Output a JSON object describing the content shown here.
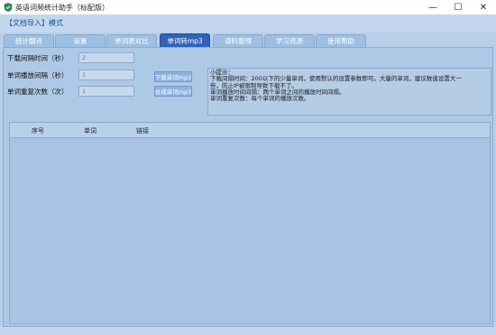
{
  "window": {
    "title": "英语词频统计助手（标配版）",
    "minimize_glyph": "—",
    "maximize_glyph": "☐",
    "close_glyph": "✕"
  },
  "mode_link": "【文档导入】模式",
  "tabs": [
    {
      "label": "统计翻译"
    },
    {
      "label": "设置"
    },
    {
      "label": "单词表对比"
    },
    {
      "label": "单词转mp3",
      "active": true
    },
    {
      "label": "语料整理"
    },
    {
      "label": "学习资源"
    },
    {
      "label": "使用帮助"
    }
  ],
  "form": {
    "download_timeout": {
      "label": "下载间隔时间（秒）",
      "value": "2"
    },
    "play_interval": {
      "label": "单词播放间隔（秒）",
      "value": "1"
    },
    "repeat_count": {
      "label": "单词重复次数（次）",
      "value": "1"
    }
  },
  "buttons": {
    "download": "下载单词mp3",
    "merge": "合成单词mp3"
  },
  "tips": [
    "小提示：",
    "下载间隔时间：200以下的少量单词，使用默认的设置参数即可。大量的单词，建议数值设置大一",
    "些，防止IP被限制导致下载不了。",
    "单词播放时间间隔：两个单词之间的播放时间间隔。",
    "单词重复次数：每个单词的播放次数。"
  ],
  "table": {
    "columns": [
      "序号",
      "单词",
      "链接"
    ]
  },
  "colors": {
    "accent": "#2f62b8",
    "panel": "#aec9e6",
    "tab": "#9dbfe2"
  },
  "icons": {
    "app": "shield-app-icon"
  }
}
